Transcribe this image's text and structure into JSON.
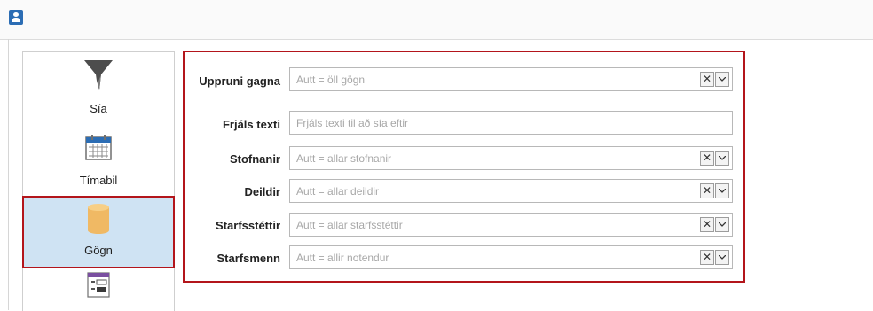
{
  "sidebar": {
    "items": [
      {
        "label": "Sía",
        "icon": "funnel-icon"
      },
      {
        "label": "Tímabil",
        "icon": "calendar-icon"
      },
      {
        "label": "Gögn",
        "icon": "database-icon"
      },
      {
        "label": "",
        "icon": "form-icon"
      }
    ]
  },
  "filters": [
    {
      "label": "Uppruni gagna",
      "placeholder": "Autt = öll gögn",
      "clearable": true
    },
    {
      "label": "Frjáls texti",
      "placeholder": "Frjáls texti til að sía eftir",
      "clearable": false
    },
    {
      "label": "Stofnanir",
      "placeholder": "Autt = allar stofnanir",
      "clearable": true
    },
    {
      "label": "Deildir",
      "placeholder": "Autt = allar deildir",
      "clearable": true
    },
    {
      "label": "Starfsstéttir",
      "placeholder": "Autt = allar starfsstéttir",
      "clearable": true
    },
    {
      "label": "Starfsmenn",
      "placeholder": "Autt = allir notendur",
      "clearable": true
    }
  ],
  "controls": {
    "clear_symbol": "✕"
  },
  "colors": {
    "highlight_border": "#b3151b",
    "selected_bg": "#cfe3f3",
    "accent": "#2c6db4"
  }
}
